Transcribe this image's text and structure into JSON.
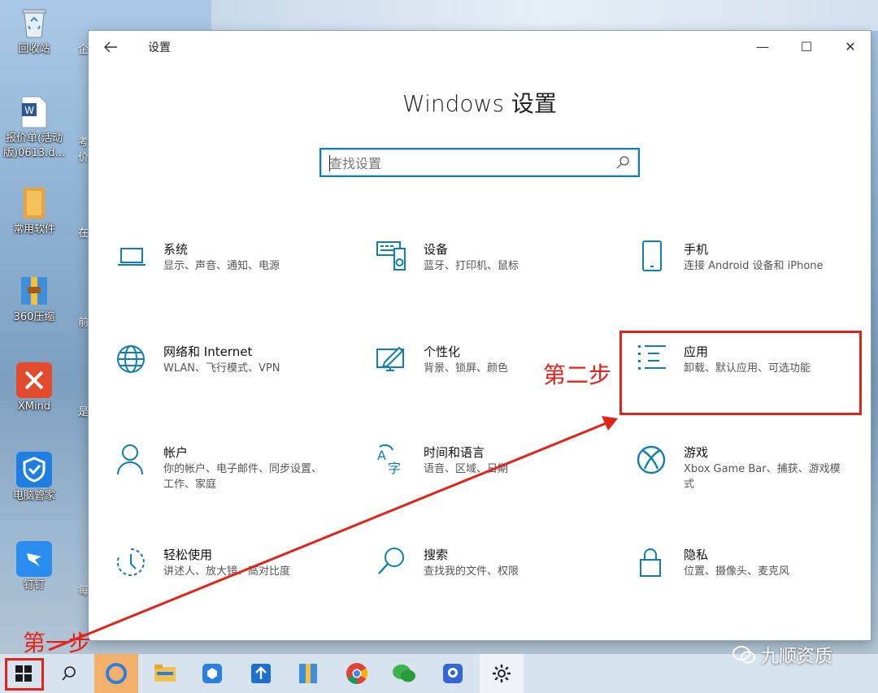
{
  "desktop": {
    "icons": [
      {
        "label": "回收站"
      },
      {
        "label": "报价单(活动\n版)0613.d..."
      },
      {
        "label": "常用软件"
      },
      {
        "label": "360压缩"
      },
      {
        "label": "XMind"
      },
      {
        "label": "电脑管家"
      },
      {
        "label": "钉钉"
      }
    ],
    "col2_fragments": [
      "企",
      "考\n价",
      "在",
      "前",
      "是",
      "",
      "每"
    ]
  },
  "window": {
    "title": "设置",
    "heading": "Windows 设置",
    "search_placeholder": "查找设置",
    "controls": {
      "minimize": "—",
      "maximize": "☐",
      "close": "✕"
    }
  },
  "tiles": [
    {
      "id": "system",
      "title": "系统",
      "desc": "显示、声音、通知、电源",
      "icon": "laptop-icon"
    },
    {
      "id": "devices",
      "title": "设备",
      "desc": "蓝牙、打印机、鼠标",
      "icon": "devices-icon"
    },
    {
      "id": "phone",
      "title": "手机",
      "desc": "连接 Android 设备和 iPhone",
      "icon": "phone-icon"
    },
    {
      "id": "network",
      "title": "网络和 Internet",
      "desc": "WLAN、飞行模式、VPN",
      "icon": "globe-icon"
    },
    {
      "id": "personalization",
      "title": "个性化",
      "desc": "背景、锁屏、颜色",
      "icon": "paint-icon"
    },
    {
      "id": "apps",
      "title": "应用",
      "desc": "卸载、默认应用、可选功能",
      "icon": "apps-list-icon"
    },
    {
      "id": "accounts",
      "title": "帐户",
      "desc": "你的帐户、电子邮件、同步设置、工作、家庭",
      "icon": "person-icon"
    },
    {
      "id": "time-language",
      "title": "时间和语言",
      "desc": "语音、区域、日期",
      "icon": "language-icon"
    },
    {
      "id": "gaming",
      "title": "游戏",
      "desc": "Xbox Game Bar、捕获、游戏模式",
      "icon": "xbox-icon"
    },
    {
      "id": "ease-of-access",
      "title": "轻松使用",
      "desc": "讲述人、放大镜、高对比度",
      "icon": "ease-access-icon"
    },
    {
      "id": "search",
      "title": "搜索",
      "desc": "查找我的文件、权限",
      "icon": "search-icon"
    },
    {
      "id": "privacy",
      "title": "隐私",
      "desc": "位置、摄像头、麦克风",
      "icon": "lock-icon"
    }
  ],
  "annotations": {
    "step1": "第一步",
    "step2": "第二步",
    "color": "#e2231a"
  },
  "taskbar": {
    "items": [
      "start-icon",
      "search-icon",
      "browser-icon",
      "file-explorer-icon",
      "app-icon",
      "upload-app-icon",
      "archive-icon",
      "chrome-icon",
      "wechat-icon",
      "camera-app-icon",
      "gear-icon"
    ]
  },
  "watermark": "九顺资质",
  "colors": {
    "accent": "#0f7eb8",
    "annotation": "#e2231a"
  }
}
